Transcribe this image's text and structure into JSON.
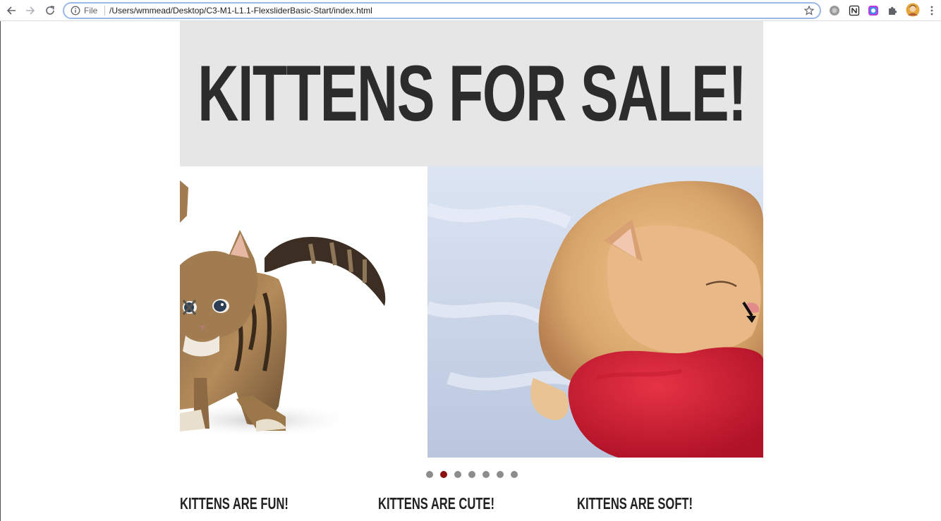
{
  "browser": {
    "scheme_label": "File",
    "url": "/Users/wmmead/Desktop/C3-M1-L1.1-FlexsliderBasic-Start/index.html",
    "icons": [
      "back-icon",
      "forward-icon",
      "reload-icon",
      "info-icon",
      "star-icon",
      "extension-icon",
      "notion-icon",
      "color-picker-icon",
      "puzzle-icon",
      "avatar",
      "more-icon"
    ]
  },
  "page": {
    "title": "KITTENS FOR SALE!",
    "slider": {
      "slides": [
        "tabby kitten walking",
        "ginger kitten sleeping on red heart pillow"
      ],
      "dot_count": 7,
      "active_dot": 2
    },
    "features": [
      {
        "heading": "KITTENS ARE FUN!"
      },
      {
        "heading": "KITTENS ARE CUTE!"
      },
      {
        "heading": "KITTENS ARE SOFT!"
      }
    ]
  },
  "colors": {
    "hero_bg": "#e6e6e6",
    "title": "#2c2c2c",
    "dot_active": "#8b1010",
    "dot": "#8c8c8c",
    "heart": "#d01f34"
  }
}
